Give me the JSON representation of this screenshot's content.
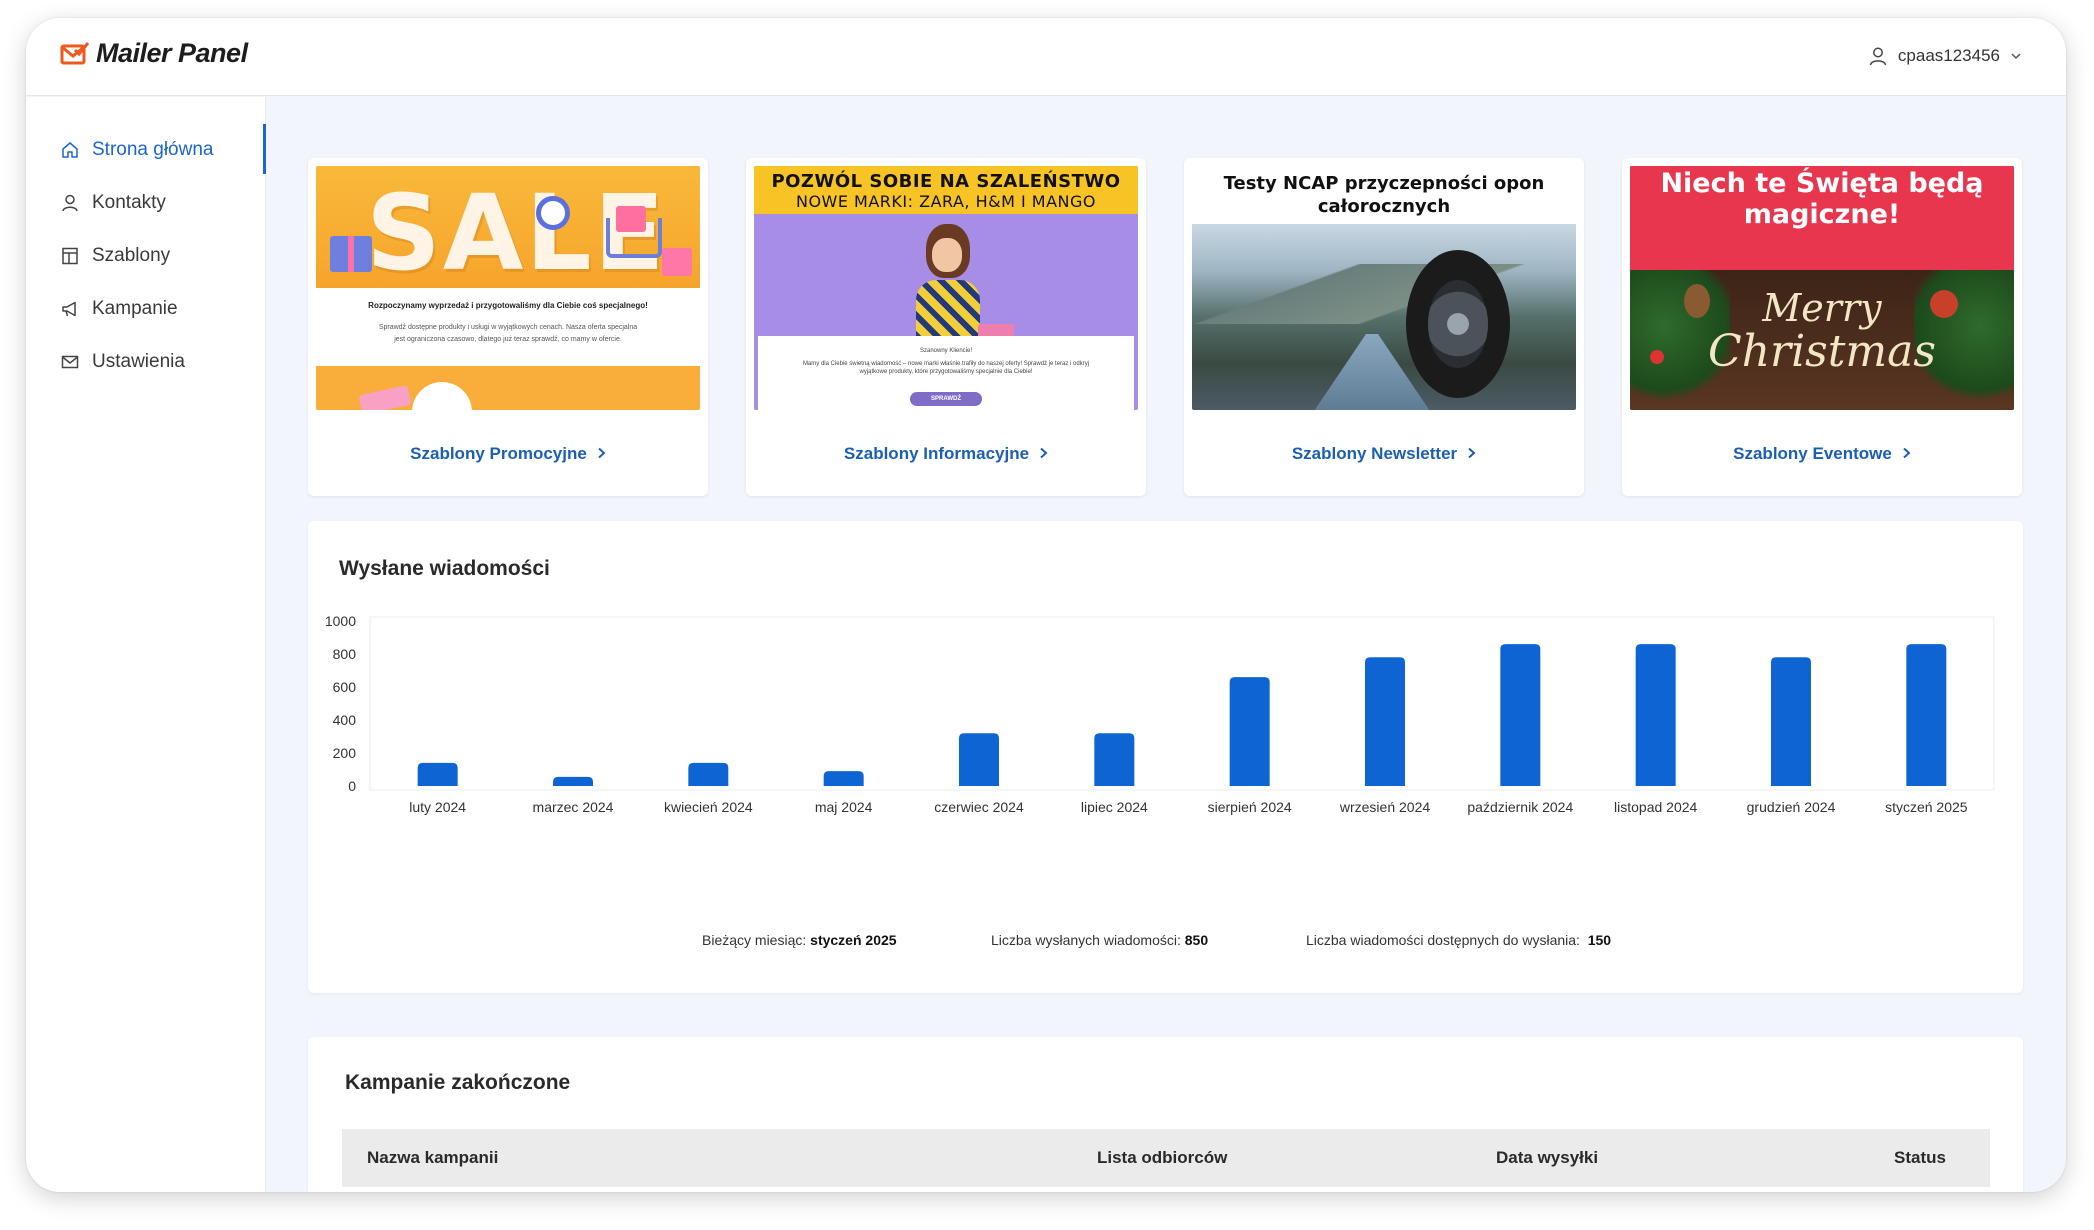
{
  "app": {
    "name": "Mailer Panel"
  },
  "user": {
    "name": "cpaas123456"
  },
  "sidebar": {
    "items": [
      {
        "label": "Strona główna"
      },
      {
        "label": "Kontakty"
      },
      {
        "label": "Szablony"
      },
      {
        "label": "Kampanie"
      },
      {
        "label": "Ustawienia"
      }
    ]
  },
  "templates": [
    {
      "link": "Szablony Promocyjne",
      "thumb": {
        "big": "SALE",
        "heading": "Rozpoczynamy wyprzedaż i przygotowaliśmy dla Ciebie coś specjalnego!",
        "body1": "Sprawdź dostępne produkty i usługi w wyjątkowych cenach. Nasza oferta specjalna",
        "body2": "jest ograniczona czasowo, dlatego już teraz sprawdź, co mamy w ofercie."
      }
    },
    {
      "link": "Szablony Informacyjne",
      "thumb": {
        "line1": "POZWÓL SOBIE NA SZALEŃSTWO",
        "line2": "NOWE MARKI: ZARA, H&M I MANGO",
        "greeting": "Szanowny Kliencie!",
        "body": "Mamy dla Ciebie świetną wiadomość – nowe marki właśnie trafiły do naszej oferty! Sprawdź je teraz i odkryj wyjątkowe produkty, które przygotowaliśmy specjalnie dla Ciebie!",
        "button": "SPRAWDŹ"
      }
    },
    {
      "link": "Szablony Newsletter",
      "thumb": {
        "title": "Testy NCAP przyczepności opon całorocznych"
      }
    },
    {
      "link": "Szablony Eventowe",
      "thumb": {
        "title": "Niech te Święta będą magiczne!",
        "script1": "Merry",
        "script2": "Christmas"
      }
    }
  ],
  "chart_section": {
    "title": "Wysłane wiadomości",
    "current_month_label": "Bieżący miesiąc:",
    "current_month_value": "styczeń 2025",
    "sent_label": "Liczba wysłanych wiadomości:",
    "sent_value": "850",
    "available_label": "Liczba wiadomości dostępnych do wysłania:",
    "available_value": "150"
  },
  "chart_data": {
    "type": "bar",
    "categories": [
      "luty 2024",
      "marzec 2024",
      "kwiecień 2024",
      "maj 2024",
      "czerwiec 2024",
      "lipiec 2024",
      "sierpień 2024",
      "wrzesień 2024",
      "październik 2024",
      "listopad 2024",
      "grudzień 2024",
      "styczeń 2025"
    ],
    "values": [
      140,
      55,
      140,
      90,
      320,
      320,
      660,
      780,
      860,
      860,
      780,
      860
    ],
    "ylim": [
      0,
      1000
    ],
    "yticks": [
      "0",
      "200",
      "400",
      "600",
      "800",
      "1000"
    ],
    "color": "#0d64d2",
    "grid": false
  },
  "campaigns": {
    "title": "Kampanie zakończone",
    "columns": [
      "Nazwa kampanii",
      "Lista odbiorców",
      "Data wysyłki",
      "Status"
    ]
  }
}
